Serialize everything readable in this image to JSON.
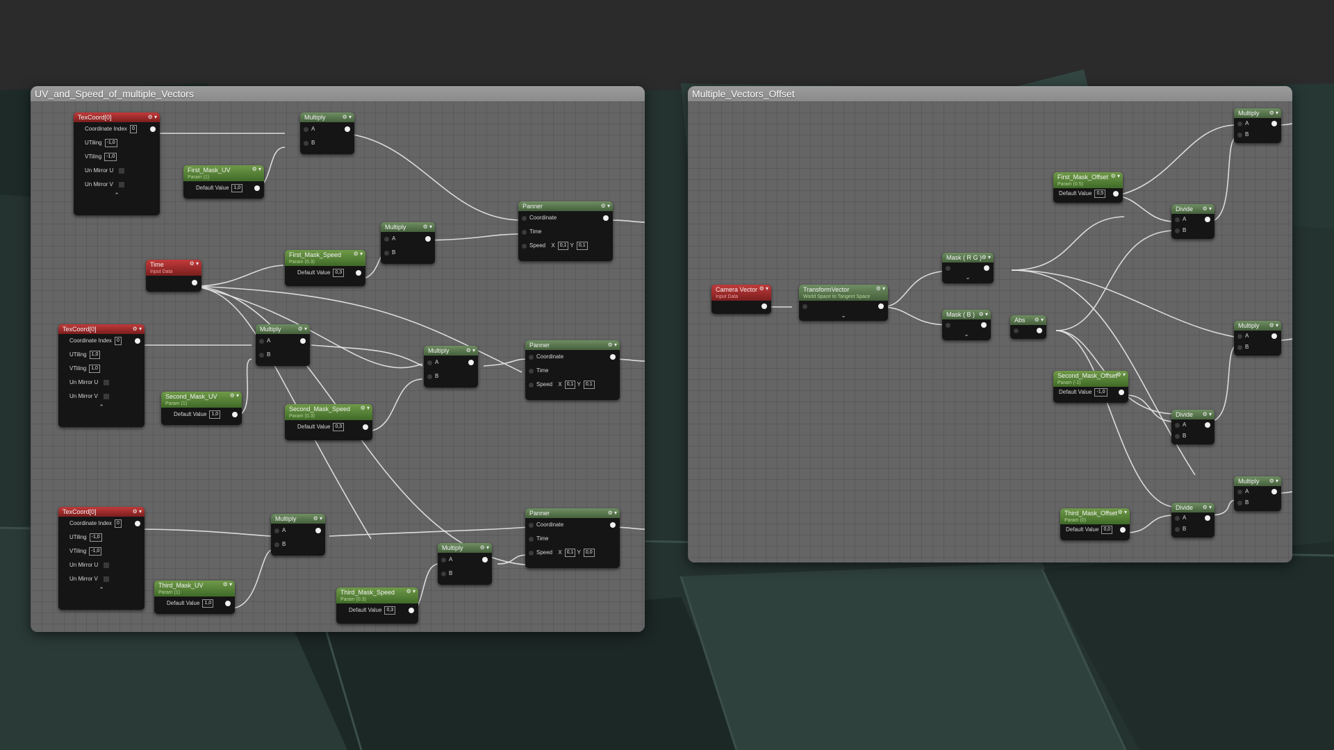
{
  "left_panel": {
    "title": "UV_and_Speed_of_multiple_Vectors",
    "nodes": {
      "texcoord1": {
        "title": "TexCoord[0]",
        "coord_label": "Coordinate Index",
        "coord": "0",
        "utiling_label": "UTiling",
        "utiling": "-1,0",
        "vtiling_label": "VTiling",
        "vtiling": "-1,0",
        "mirror_u": "Un Mirror U",
        "mirror_v": "Un Mirror V"
      },
      "texcoord2": {
        "title": "TexCoord[0]",
        "coord_label": "Coordinate Index",
        "coord": "0",
        "utiling_label": "UTiling",
        "utiling": "1,0",
        "vtiling_label": "VTiling",
        "vtiling": "1,0",
        "mirror_u": "Un Mirror U",
        "mirror_v": "Un Mirror V"
      },
      "texcoord3": {
        "title": "TexCoord[0]",
        "coord_label": "Coordinate Index",
        "coord": "0",
        "utiling_label": "UTiling",
        "utiling": "-1,0",
        "vtiling_label": "VTiling",
        "vtiling": "-1,0",
        "mirror_u": "Un Mirror U",
        "mirror_v": "Un Mirror V"
      },
      "first_mask_uv": {
        "title": "First_Mask_UV",
        "sub": "Param (1)",
        "label": "Default Value",
        "value": "1,0"
      },
      "second_mask_uv": {
        "title": "Second_Mask_UV",
        "sub": "Param (1)",
        "label": "Default Value",
        "value": "1,0"
      },
      "third_mask_uv": {
        "title": "Third_Mask_UV",
        "sub": "Param (1)",
        "label": "Default Value",
        "value": "1,0"
      },
      "first_mask_speed": {
        "title": "First_Mask_Speed",
        "sub": "Param (0.3)",
        "label": "Default Value",
        "value": "0,3"
      },
      "second_mask_speed": {
        "title": "Second_Mask_Speed",
        "sub": "Param (0.3)",
        "label": "Default Value",
        "value": "0,3"
      },
      "third_mask_speed": {
        "title": "Third_Mask_Speed",
        "sub": "Param (0.3)",
        "label": "Default Value",
        "value": "0,3"
      },
      "time": {
        "title": "Time",
        "sub": "Input Data"
      },
      "multiply": {
        "title": "Multiply",
        "a": "A",
        "b": "B"
      },
      "panner1": {
        "title": "Panner",
        "coordinate": "Coordinate",
        "time": "Time",
        "speed": "Speed",
        "x_label": "X",
        "x": "0,1",
        "y_label": "Y",
        "y": "0,1"
      },
      "panner2": {
        "title": "Panner",
        "coordinate": "Coordinate",
        "time": "Time",
        "speed": "Speed",
        "x_label": "X",
        "x": "0,1",
        "y_label": "Y",
        "y": "0,1"
      },
      "panner3": {
        "title": "Panner",
        "coordinate": "Coordinate",
        "time": "Time",
        "speed": "Speed",
        "x_label": "X",
        "x": "0,1",
        "y_label": "Y",
        "y": "0,0"
      }
    }
  },
  "right_panel": {
    "title": "Multiple_Vectors_Offset",
    "nodes": {
      "camera_vector": {
        "title": "Camera Vector",
        "sub": "Input Data"
      },
      "transform_vector": {
        "title": "TransformVector",
        "sub": "World Space to Tangent Space"
      },
      "mask_rg": {
        "title": "Mask ( R G )"
      },
      "mask_b": {
        "title": "Mask ( B )"
      },
      "abs": {
        "title": "Abs"
      },
      "first_mask_offset": {
        "title": "First_Mask_Offset",
        "sub": "Param (0.5)",
        "label": "Default Value",
        "value": "0,5"
      },
      "second_mask_offset": {
        "title": "Second_Mask_Offset",
        "sub": "Param (-1)",
        "label": "Default Value",
        "value": "-1,0"
      },
      "third_mask_offset": {
        "title": "Third_Mask_Offset",
        "sub": "Param (0)",
        "label": "Default Value",
        "value": "0,0"
      },
      "divide": {
        "title": "Divide",
        "a": "A",
        "b": "B"
      },
      "multiply": {
        "title": "Multiply",
        "a": "A",
        "b": "B"
      }
    }
  }
}
